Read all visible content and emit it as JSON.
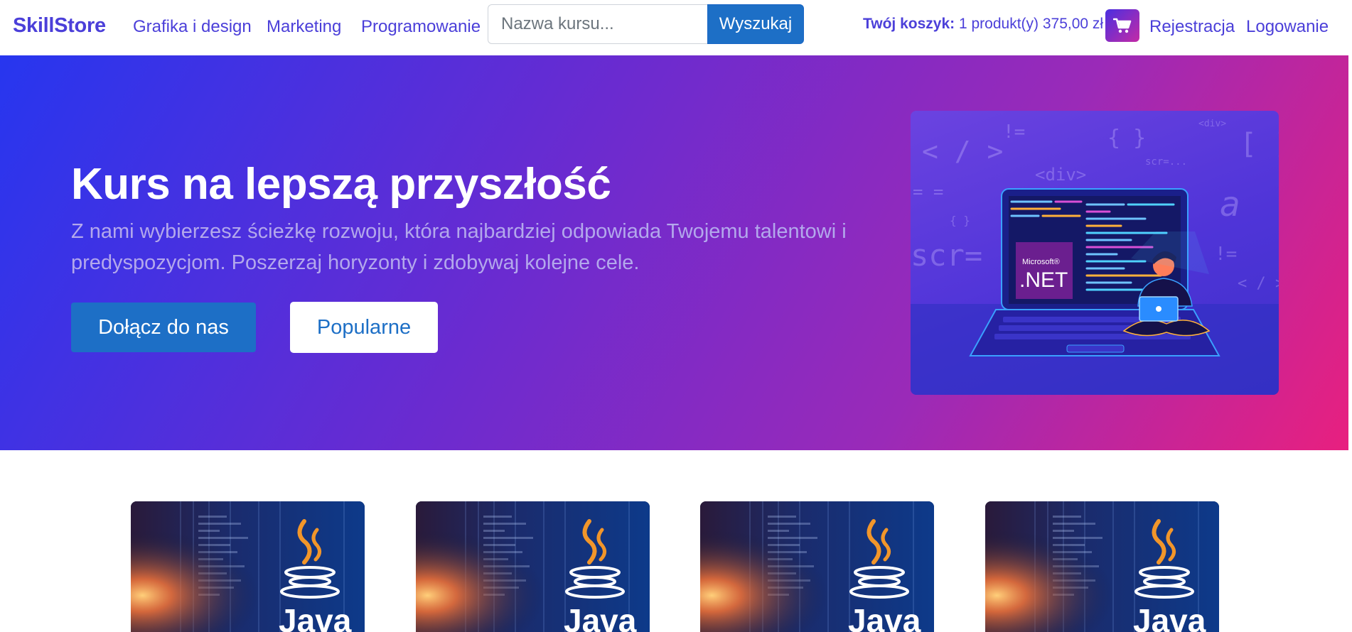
{
  "nav": {
    "brand": "SkillStore",
    "links": [
      "Grafika i design",
      "Marketing",
      "Programowanie"
    ],
    "search_placeholder": "Nazwa kursu...",
    "search_button": "Wyszukaj",
    "cart_label": "Twój koszyk:",
    "cart_summary": "1 produkt(y) 375,00 zł",
    "register": "Rejestracja",
    "login": "Logowanie"
  },
  "hero": {
    "title": "Kurs na lepszą przyszłość",
    "subtitle": "Z nami wybierzesz ścieżkę rozwoju, która najbardziej odpowiada Twojemu talentowi i predyspozycjom. Poszerzaj horyzonty i zdobywaj kolejne cele.",
    "join_button": "Dołącz do nas",
    "popular_button": "Popularne",
    "illustration": {
      "logo_small": "Microsoft®",
      "logo_big": ".NET",
      "code_tokens": [
        "!=",
        "{ }",
        "<div>",
        "[ ]",
        "< / >",
        "scr=...",
        "<div>",
        "= =",
        "{ }",
        "a",
        "scr=",
        "!=",
        "< / >"
      ]
    }
  },
  "courses": [
    {
      "logo_text": "Java"
    },
    {
      "logo_text": "Java"
    },
    {
      "logo_text": "Java"
    },
    {
      "logo_text": "Java"
    }
  ],
  "colors": {
    "brand": "#4b3fd9",
    "primary_button": "#1d6fc6",
    "hero_start": "#2736ef",
    "hero_end": "#e8207f"
  }
}
